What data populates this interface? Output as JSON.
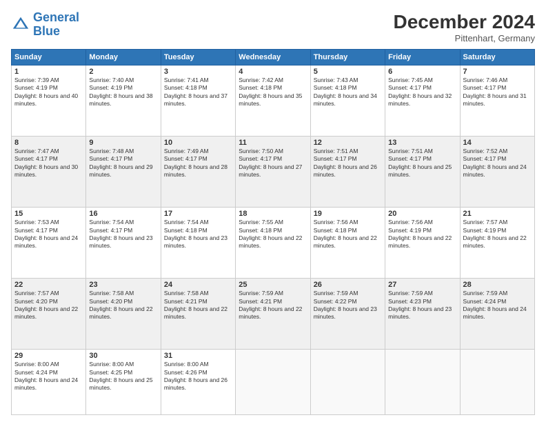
{
  "logo": {
    "line1": "General",
    "line2": "Blue"
  },
  "title": "December 2024",
  "subtitle": "Pittenhart, Germany",
  "days_of_week": [
    "Sunday",
    "Monday",
    "Tuesday",
    "Wednesday",
    "Thursday",
    "Friday",
    "Saturday"
  ],
  "weeks": [
    [
      {
        "day": 1,
        "sunrise": "7:39 AM",
        "sunset": "4:19 PM",
        "daylight": "8 hours and 40 minutes."
      },
      {
        "day": 2,
        "sunrise": "7:40 AM",
        "sunset": "4:19 PM",
        "daylight": "8 hours and 38 minutes."
      },
      {
        "day": 3,
        "sunrise": "7:41 AM",
        "sunset": "4:18 PM",
        "daylight": "8 hours and 37 minutes."
      },
      {
        "day": 4,
        "sunrise": "7:42 AM",
        "sunset": "4:18 PM",
        "daylight": "8 hours and 35 minutes."
      },
      {
        "day": 5,
        "sunrise": "7:43 AM",
        "sunset": "4:18 PM",
        "daylight": "8 hours and 34 minutes."
      },
      {
        "day": 6,
        "sunrise": "7:45 AM",
        "sunset": "4:17 PM",
        "daylight": "8 hours and 32 minutes."
      },
      {
        "day": 7,
        "sunrise": "7:46 AM",
        "sunset": "4:17 PM",
        "daylight": "8 hours and 31 minutes."
      }
    ],
    [
      {
        "day": 8,
        "sunrise": "7:47 AM",
        "sunset": "4:17 PM",
        "daylight": "8 hours and 30 minutes."
      },
      {
        "day": 9,
        "sunrise": "7:48 AM",
        "sunset": "4:17 PM",
        "daylight": "8 hours and 29 minutes."
      },
      {
        "day": 10,
        "sunrise": "7:49 AM",
        "sunset": "4:17 PM",
        "daylight": "8 hours and 28 minutes."
      },
      {
        "day": 11,
        "sunrise": "7:50 AM",
        "sunset": "4:17 PM",
        "daylight": "8 hours and 27 minutes."
      },
      {
        "day": 12,
        "sunrise": "7:51 AM",
        "sunset": "4:17 PM",
        "daylight": "8 hours and 26 minutes."
      },
      {
        "day": 13,
        "sunrise": "7:51 AM",
        "sunset": "4:17 PM",
        "daylight": "8 hours and 25 minutes."
      },
      {
        "day": 14,
        "sunrise": "7:52 AM",
        "sunset": "4:17 PM",
        "daylight": "8 hours and 24 minutes."
      }
    ],
    [
      {
        "day": 15,
        "sunrise": "7:53 AM",
        "sunset": "4:17 PM",
        "daylight": "8 hours and 24 minutes."
      },
      {
        "day": 16,
        "sunrise": "7:54 AM",
        "sunset": "4:17 PM",
        "daylight": "8 hours and 23 minutes."
      },
      {
        "day": 17,
        "sunrise": "7:54 AM",
        "sunset": "4:18 PM",
        "daylight": "8 hours and 23 minutes."
      },
      {
        "day": 18,
        "sunrise": "7:55 AM",
        "sunset": "4:18 PM",
        "daylight": "8 hours and 22 minutes."
      },
      {
        "day": 19,
        "sunrise": "7:56 AM",
        "sunset": "4:18 PM",
        "daylight": "8 hours and 22 minutes."
      },
      {
        "day": 20,
        "sunrise": "7:56 AM",
        "sunset": "4:19 PM",
        "daylight": "8 hours and 22 minutes."
      },
      {
        "day": 21,
        "sunrise": "7:57 AM",
        "sunset": "4:19 PM",
        "daylight": "8 hours and 22 minutes."
      }
    ],
    [
      {
        "day": 22,
        "sunrise": "7:57 AM",
        "sunset": "4:20 PM",
        "daylight": "8 hours and 22 minutes."
      },
      {
        "day": 23,
        "sunrise": "7:58 AM",
        "sunset": "4:20 PM",
        "daylight": "8 hours and 22 minutes."
      },
      {
        "day": 24,
        "sunrise": "7:58 AM",
        "sunset": "4:21 PM",
        "daylight": "8 hours and 22 minutes."
      },
      {
        "day": 25,
        "sunrise": "7:59 AM",
        "sunset": "4:21 PM",
        "daylight": "8 hours and 22 minutes."
      },
      {
        "day": 26,
        "sunrise": "7:59 AM",
        "sunset": "4:22 PM",
        "daylight": "8 hours and 23 minutes."
      },
      {
        "day": 27,
        "sunrise": "7:59 AM",
        "sunset": "4:23 PM",
        "daylight": "8 hours and 23 minutes."
      },
      {
        "day": 28,
        "sunrise": "7:59 AM",
        "sunset": "4:24 PM",
        "daylight": "8 hours and 24 minutes."
      }
    ],
    [
      {
        "day": 29,
        "sunrise": "8:00 AM",
        "sunset": "4:24 PM",
        "daylight": "8 hours and 24 minutes."
      },
      {
        "day": 30,
        "sunrise": "8:00 AM",
        "sunset": "4:25 PM",
        "daylight": "8 hours and 25 minutes."
      },
      {
        "day": 31,
        "sunrise": "8:00 AM",
        "sunset": "4:26 PM",
        "daylight": "8 hours and 26 minutes."
      },
      null,
      null,
      null,
      null
    ]
  ]
}
